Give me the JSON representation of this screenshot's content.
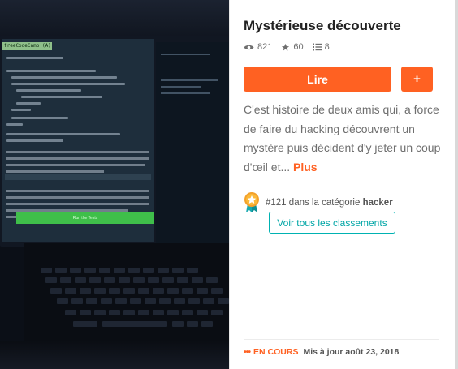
{
  "story": {
    "title": "Mystérieuse découverte",
    "stats": {
      "reads": "821",
      "votes": "60",
      "parts": "8"
    },
    "read_button_label": "Lire",
    "add_button_label": "+",
    "description": "C'est histoire de deux amis qui, a force de faire du hacking découvrent un mystère puis décident d'y jeter un coup d'œil et...",
    "more_label": "Plus",
    "ranking": {
      "position": "#121",
      "text": "dans la catégorie",
      "category": "hacker"
    },
    "ranks_button_label": "Voir tous les classements",
    "footer": {
      "dots": "•••",
      "status": "EN COURS",
      "updated": "Mis à jour août 23, 2018"
    }
  },
  "cover": {
    "tab_label": "freeCodeCamp (A)",
    "run_label": "Run the Tests"
  },
  "colors": {
    "accent": "#ff6122",
    "teal": "#00a6a6",
    "text_muted": "#6f6f6f",
    "title": "#222222"
  }
}
